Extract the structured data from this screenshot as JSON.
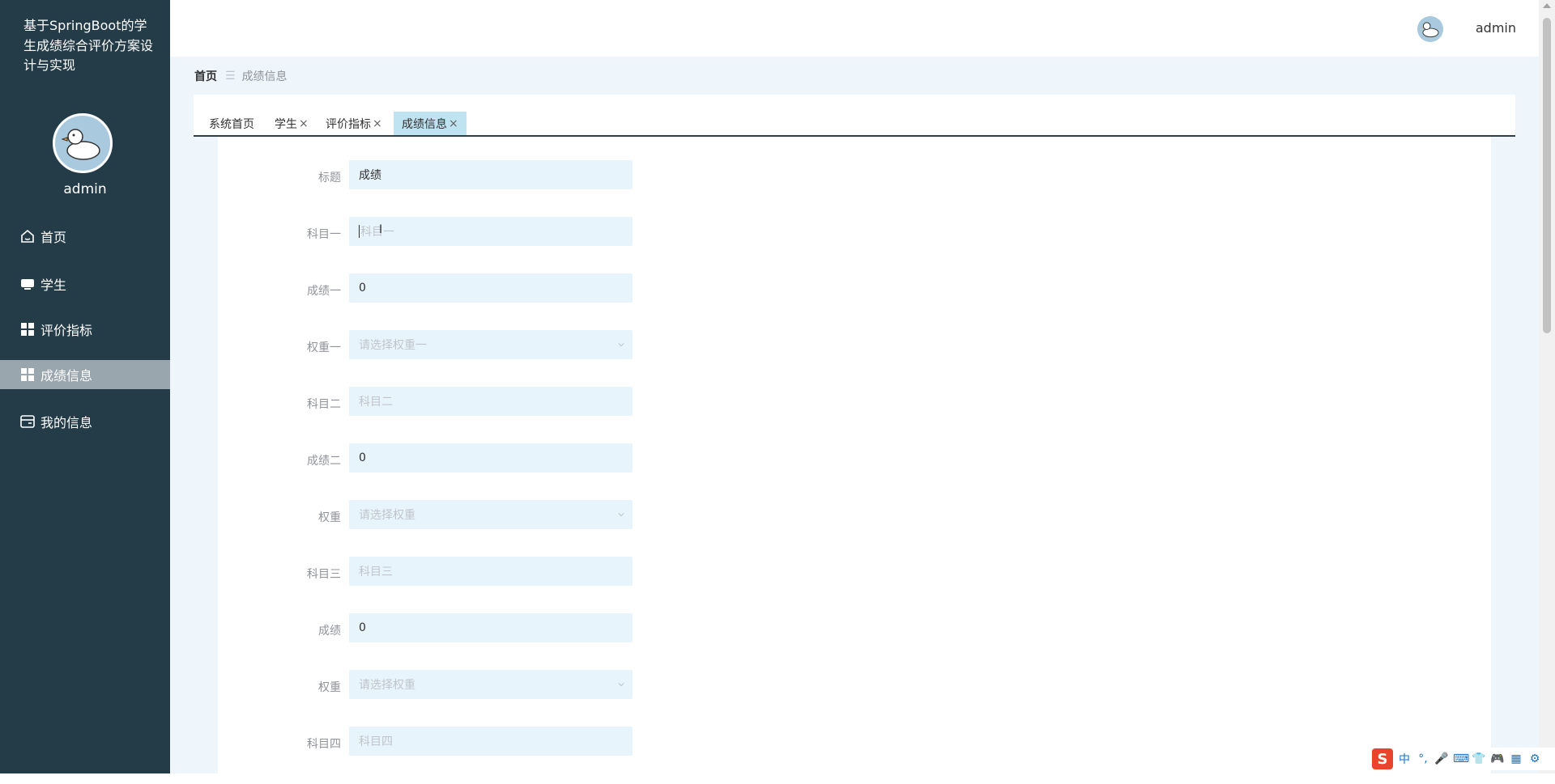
{
  "app": {
    "title": "基于SpringBoot的学生成绩综合评价方案设计与实现",
    "username": "admin"
  },
  "sidebar": {
    "items": [
      {
        "label": "首页",
        "icon": "home-icon"
      },
      {
        "label": "学生",
        "icon": "monitor-icon"
      },
      {
        "label": "评价指标",
        "icon": "grid-icon"
      },
      {
        "label": "成绩信息",
        "icon": "grid-icon",
        "active": true
      },
      {
        "label": "我的信息",
        "icon": "card-icon"
      }
    ]
  },
  "header": {
    "username": "admin"
  },
  "breadcrumb": {
    "home": "首页",
    "separator": "☰",
    "current": "成绩信息"
  },
  "tabs": [
    {
      "label": "系统首页",
      "closable": false
    },
    {
      "label": "学生",
      "closable": true
    },
    {
      "label": "评价指标",
      "closable": true
    },
    {
      "label": "成绩信息",
      "closable": true,
      "active": true
    }
  ],
  "tab_close_glyph": "×",
  "form": {
    "fields": [
      {
        "label": "标题",
        "value": "成绩",
        "placeholder": "",
        "type": "input"
      },
      {
        "label": "科目一",
        "value": "",
        "placeholder": "科目一",
        "type": "input",
        "focused": true
      },
      {
        "label": "成绩一",
        "value": "0",
        "placeholder": "",
        "type": "input"
      },
      {
        "label": "权重一",
        "value": "",
        "placeholder": "请选择权重一",
        "type": "select"
      },
      {
        "label": "科目二",
        "value": "",
        "placeholder": "科目二",
        "type": "input"
      },
      {
        "label": "成绩二",
        "value": "0",
        "placeholder": "",
        "type": "input"
      },
      {
        "label": "权重",
        "value": "",
        "placeholder": "请选择权重",
        "type": "select"
      },
      {
        "label": "科目三",
        "value": "",
        "placeholder": "科目三",
        "type": "input"
      },
      {
        "label": "成绩",
        "value": "0",
        "placeholder": "",
        "type": "input"
      },
      {
        "label": "权重",
        "value": "",
        "placeholder": "请选择权重",
        "type": "select"
      },
      {
        "label": "科目四",
        "value": "",
        "placeholder": "科目四",
        "type": "input"
      }
    ]
  },
  "ime": {
    "logo": "S",
    "items": [
      "中",
      "°,",
      "🎤",
      "⌨",
      "👕",
      "🎮",
      "▦",
      "⚙"
    ]
  },
  "colors": {
    "sidebar_bg": "#243c48",
    "sidebar_active": "#9aa6ad",
    "main_bg": "#eef6fb",
    "field_bg": "#e8f4fb",
    "tab_active_bg": "#bfe3f0"
  }
}
